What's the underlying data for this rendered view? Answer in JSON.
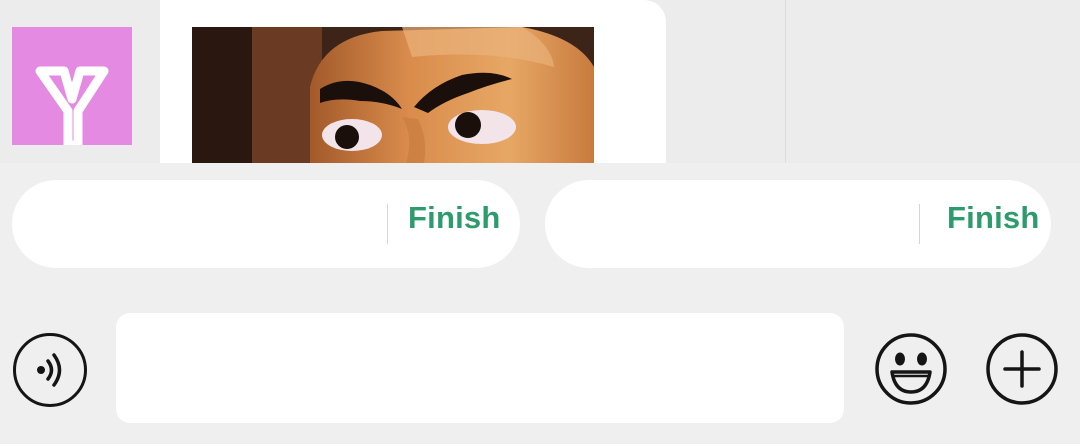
{
  "quick_replies": [
    {
      "label": "Finish"
    },
    {
      "label": "Finish"
    }
  ],
  "composer": {
    "text_value": "",
    "voice_icon": "voice-icon",
    "emoji_icon": "emoji-icon",
    "plus_icon": "plus-icon"
  },
  "chat": {
    "avatar_color": "#e58ae3",
    "sticker_icon": "angry-eyes-sticker"
  },
  "colors": {
    "accent_green": "#2d9b6b",
    "background": "#efefef",
    "bubble": "#ffffff"
  }
}
